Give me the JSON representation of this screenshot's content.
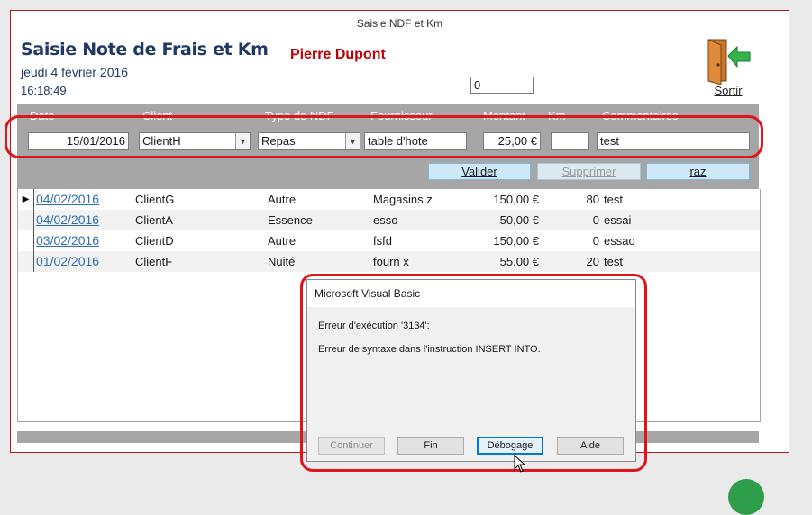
{
  "window": {
    "title": "Saisie NDF et Km"
  },
  "header": {
    "form_title": "Saisie Note de Frais et Km",
    "date": "jeudi 4 février 2016",
    "time": "16:18:49",
    "user_name": "Pierre Dupont",
    "counter_value": "0",
    "exit_label": "Sortir"
  },
  "entry": {
    "headers": {
      "date": "Date",
      "client": "Client",
      "type": "Type de NDF",
      "supplier": "Fournisseur",
      "amount": "Montant",
      "km": "Km",
      "comments": "Commentaires"
    },
    "values": {
      "date": "15/01/2016",
      "client": "ClientH",
      "type": "Repas",
      "supplier": "table d'hote",
      "amount": "25,00 €",
      "km": "",
      "comments": "test"
    },
    "buttons": {
      "validate": "Valider",
      "delete": "Supprimer",
      "reset": "raz"
    }
  },
  "rows": [
    {
      "date": "04/02/2016",
      "client": "ClientG",
      "type": "Autre",
      "supplier": "Magasins z",
      "amount": "150,00 €",
      "km": "80",
      "comment": "test"
    },
    {
      "date": "04/02/2016",
      "client": "ClientA",
      "type": "Essence",
      "supplier": "esso",
      "amount": "50,00 €",
      "km": "0",
      "comment": "essai"
    },
    {
      "date": "03/02/2016",
      "client": "ClientD",
      "type": "Autre",
      "supplier": "fsfd",
      "amount": "150,00 €",
      "km": "0",
      "comment": "essao"
    },
    {
      "date": "01/02/2016",
      "client": "ClientF",
      "type": "Nuité",
      "supplier": "fourn x",
      "amount": "55,00 €",
      "km": "20",
      "comment": "test"
    }
  ],
  "dialog": {
    "title": "Microsoft Visual Basic",
    "message_1": "Erreur d'exécution '3134':",
    "message_2": "Erreur de syntaxe dans l'instruction INSERT INTO.",
    "buttons": {
      "continue": "Continuer",
      "end": "Fin",
      "debug": "Débogage",
      "help": "Aide"
    }
  },
  "colors": {
    "accent_red": "#e0141c",
    "title_blue": "#1f3864",
    "user_red": "#c00000",
    "panel_gray": "#a6a6a6",
    "button_blue": "#cfe8f8"
  }
}
